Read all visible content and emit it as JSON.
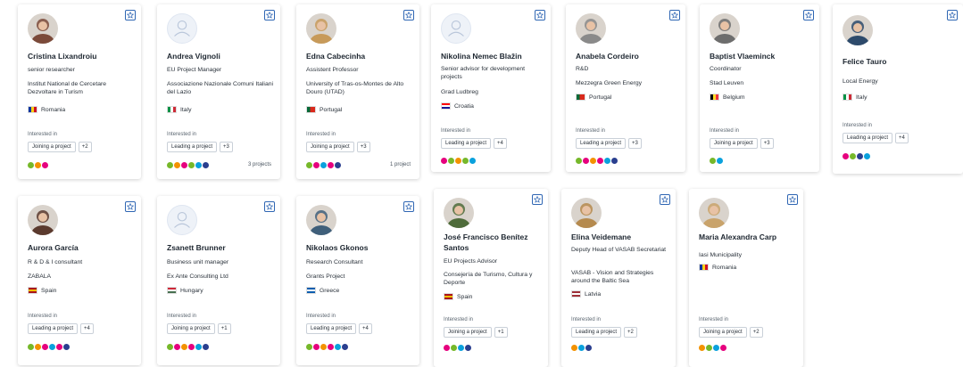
{
  "cards": [
    {
      "name": "Cristina Lixandroiu",
      "role": "senior researcher",
      "org": "Institut National de Cercetare Dezvoltare in Turism",
      "country": "Romania",
      "flag": [
        "#0033a0",
        "#fcd116",
        "#ce1126"
      ],
      "interested_label": "Interested in",
      "interest": "Joining a project",
      "more": "+2",
      "dots": [
        "#76b82a",
        "#f39200",
        "#e6007e"
      ],
      "projects": "",
      "avatar": "photo",
      "avatar_color": "#7b4a3a"
    },
    {
      "name": "Andrea Vignoli",
      "role": "EU Project Manager",
      "org": "Associazione Nazionale Comuni Italiani del Lazio",
      "country": "Italy",
      "flag": [
        "#009246",
        "#ffffff",
        "#ce2b37"
      ],
      "interested_label": "Interested in",
      "interest": "Leading a project",
      "more": "+3",
      "dots": [
        "#76b82a",
        "#f39200",
        "#e6007e",
        "#76b82a",
        "#0aa1dd",
        "#2a3f8f"
      ],
      "projects": "3 projects",
      "avatar": "placeholder",
      "avatar_color": ""
    },
    {
      "name": "Edna Cabecinha",
      "role": "Assistent Professor",
      "org": "University of Tras-os-Montes de Alto Douro (UTAD)",
      "country": "Portugal",
      "flag": [
        "#046a38",
        "#da291c",
        "#da291c"
      ],
      "interested_label": "Interested in",
      "interest": "Joining a project",
      "more": "+3",
      "dots": [
        "#76b82a",
        "#e6007e",
        "#0aa1dd",
        "#e6007e",
        "#2a3f8f"
      ],
      "projects": "1 project",
      "avatar": "photo",
      "avatar_color": "#c79a5a"
    },
    {
      "name": "Nikolina Nemec Blažin",
      "role": "Senior advisor for development projects",
      "org": "Grad Ludbreg",
      "country": "Croatia",
      "flag": [
        "#ff0000",
        "#ffffff",
        "#171796"
      ],
      "interested_label": "Interested in",
      "interest": "Leading a project",
      "more": "+4",
      "dots": [
        "#e6007e",
        "#76b82a",
        "#f39200",
        "#76b82a",
        "#0aa1dd"
      ],
      "projects": "",
      "avatar": "placeholder",
      "avatar_color": ""
    },
    {
      "name": "Anabela Cordeiro",
      "role": "R&D",
      "org": "Mezzegra Green Energy",
      "country": "Portugal",
      "flag": [
        "#046a38",
        "#da291c",
        "#da291c"
      ],
      "interested_label": "Interested in",
      "interest": "Leading a project",
      "more": "+3",
      "dots": [
        "#76b82a",
        "#e6007e",
        "#f39200",
        "#e6007e",
        "#0aa1dd",
        "#2a3f8f"
      ],
      "projects": "",
      "avatar": "photo",
      "avatar_color": "#8a8a8a"
    },
    {
      "name": "Baptist Vlaeminck",
      "role": "Coordinator",
      "org": "Stad Leuven",
      "country": "Belgium",
      "flag": [
        "#000000",
        "#fdda24",
        "#ef3340"
      ],
      "interested_label": "Interested in",
      "interest": "Joining a project",
      "more": "+3",
      "dots": [
        "#76b82a",
        "#0aa1dd"
      ],
      "projects": "",
      "avatar": "photo",
      "avatar_color": "#6d6d6d"
    },
    {
      "name": "Felice Tauro",
      "role": "Local Energy",
      "org": "",
      "country": "Italy",
      "flag": [
        "#009246",
        "#ffffff",
        "#ce2b37"
      ],
      "interested_label": "Interested in",
      "interest": "Leading a project",
      "more": "+4",
      "dots": [
        "#e6007e",
        "#76b82a",
        "#2a3f8f",
        "#0aa1dd"
      ],
      "projects": "",
      "avatar": "photo",
      "avatar_color": "#2d4a6b"
    },
    {
      "name": "Aurora García",
      "role": "R & D & I consultant",
      "org": "ZABALA",
      "country": "Spain",
      "flag": [
        "#aa151b",
        "#f1bf00",
        "#aa151b"
      ],
      "interested_label": "Interested in",
      "interest": "Leading a project",
      "more": "+4",
      "dots": [
        "#76b82a",
        "#f39200",
        "#e6007e",
        "#0aa1dd",
        "#e6007e",
        "#2a3f8f"
      ],
      "projects": "",
      "avatar": "photo",
      "avatar_color": "#5b3a2e"
    },
    {
      "name": "Zsanett Brunner",
      "role": "Business unit manager",
      "org": "Ex Ante Consulting Ltd",
      "country": "Hungary",
      "flag": [
        "#ce2939",
        "#ffffff",
        "#477050"
      ],
      "interested_label": "Interested in",
      "interest": "Joining a project",
      "more": "+1",
      "dots": [
        "#76b82a",
        "#e6007e",
        "#f39200",
        "#e6007e",
        "#0aa1dd",
        "#2a3f8f"
      ],
      "projects": "",
      "avatar": "placeholder",
      "avatar_color": ""
    },
    {
      "name": "Nikolaos Gkonos",
      "role": "Research Consultant",
      "org": "Grants Project",
      "country": "Greece",
      "flag": [
        "#0d5eaf",
        "#ffffff",
        "#0d5eaf"
      ],
      "interested_label": "Interested in",
      "interest": "Leading a project",
      "more": "+4",
      "dots": [
        "#76b82a",
        "#e6007e",
        "#f39200",
        "#e6007e",
        "#0aa1dd",
        "#2a3f8f"
      ],
      "projects": "",
      "avatar": "photo",
      "avatar_color": "#3f5f7a"
    },
    {
      "name": "José Francisco Benítez Santos",
      "role": "EU Projects Advisor",
      "org": "Consejería de Turismo, Cultura y Deporte",
      "country": "Spain",
      "flag": [
        "#aa151b",
        "#f1bf00",
        "#aa151b"
      ],
      "interested_label": "Interested in",
      "interest": "Joining a project",
      "more": "+1",
      "dots": [
        "#e6007e",
        "#76b82a",
        "#0aa1dd",
        "#2a3f8f"
      ],
      "projects": "",
      "avatar": "photo",
      "avatar_color": "#4e6b3a"
    },
    {
      "name": "Elina Veidemane",
      "role": "Deputy Head of VASAB Secretariat",
      "org": "VASAB - Vision and Strategies around the Baltic Sea",
      "country": "Latvia",
      "flag": [
        "#9e3039",
        "#ffffff",
        "#9e3039"
      ],
      "interested_label": "Interested in",
      "interest": "Leading a project",
      "more": "+2",
      "dots": [
        "#f39200",
        "#0aa1dd",
        "#2a3f8f"
      ],
      "projects": "",
      "avatar": "photo",
      "avatar_color": "#b58a4e"
    },
    {
      "name": "Maria Alexandra Carp",
      "role": "Iasi Municipality",
      "org": "",
      "country": "Romania",
      "flag": [
        "#0033a0",
        "#fcd116",
        "#ce1126"
      ],
      "interested_label": "Interested in",
      "interest": "Joining a project",
      "more": "+2",
      "dots": [
        "#f39200",
        "#76b82a",
        "#0aa1dd",
        "#e6007e"
      ],
      "projects": "",
      "avatar": "photo",
      "avatar_color": "#c9a36b"
    }
  ]
}
